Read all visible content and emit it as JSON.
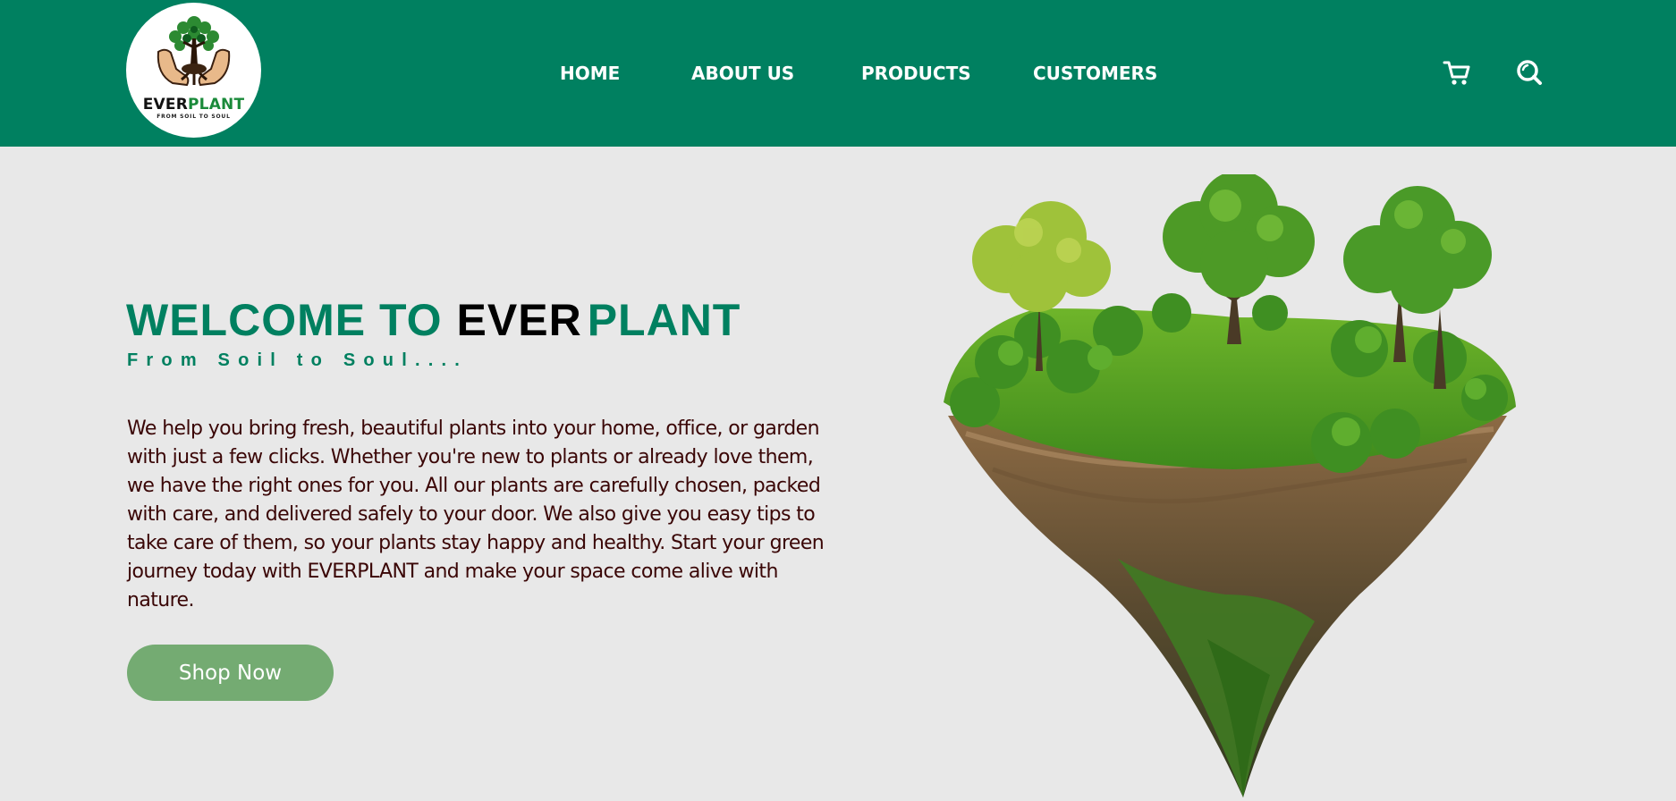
{
  "brand": {
    "logo_word_dark": "EVER",
    "logo_word_green": "PLANT",
    "logo_tagline": "FROM SOIL TO SOUL"
  },
  "nav": {
    "items": [
      {
        "label": "HOME"
      },
      {
        "label": "ABOUT US"
      },
      {
        "label": "PRODUCTS"
      },
      {
        "label": "CUSTOMERS"
      }
    ],
    "cart_icon": "cart-icon",
    "search_icon": "search-icon"
  },
  "hero": {
    "title_part1": "WELCOME TO",
    "title_part2": "EVER",
    "title_part3": "PLANT",
    "tagline": "From Soil to Soul....",
    "description": "We help you bring fresh, beautiful plants into your home, office, or garden with just a few clicks. Whether you're new to plants or already love them, we have the right ones for you. All our plants are carefully chosen, packed with care, and delivered safely to your door. We also give you easy tips to take care of them, so your plants stay happy and healthy. Start your green journey today with EVERPLANT and make your space come alive with nature.",
    "cta_label": "Shop Now"
  },
  "colors": {
    "header_bg": "#008060",
    "page_bg": "#e8e8e8",
    "accent_green": "#008060",
    "button_bg": "#74ab72",
    "body_text": "#3a0606"
  }
}
